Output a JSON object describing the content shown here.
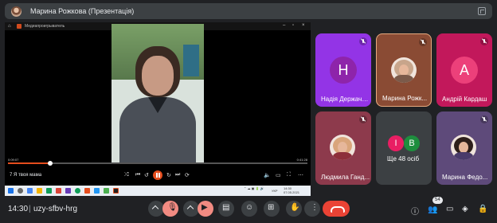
{
  "presenter_bar": {
    "name": "Марина Рожкова (Презентація)"
  },
  "player": {
    "window_title": "Медиапроигрыватель",
    "caption": "7 Я твоя мама",
    "time_elapsed": "0:09:07",
    "time_total": "0:41:28",
    "progress": 0.14,
    "tray_lang": "УКР",
    "tray_time": "14:30",
    "tray_date": "07.05.2021"
  },
  "tiles": [
    {
      "name": "Надія Держаче...",
      "letter": "Н",
      "color": "#9334e6"
    },
    {
      "name": "Марина Рожк...",
      "type": "photo"
    },
    {
      "name": "Андрій Кардаш",
      "letter": "А",
      "color": "#ec407a"
    },
    {
      "name": "Людмила Ганд...",
      "type": "photo"
    },
    {
      "name": "Ще 48 осіб",
      "type": "others",
      "letters": [
        "І",
        "B"
      ]
    },
    {
      "name": "Марина Федо...",
      "type": "photo"
    }
  ],
  "bottom_bar": {
    "time": "14:30",
    "separator": "|",
    "meeting_code": "uzy-sfbv-hrg",
    "participants_count": "54"
  },
  "colors": {
    "background": "#202124",
    "leave_red": "#ea4335",
    "muted_red": "#f28b82",
    "accent_orange": "#e54d1d"
  }
}
